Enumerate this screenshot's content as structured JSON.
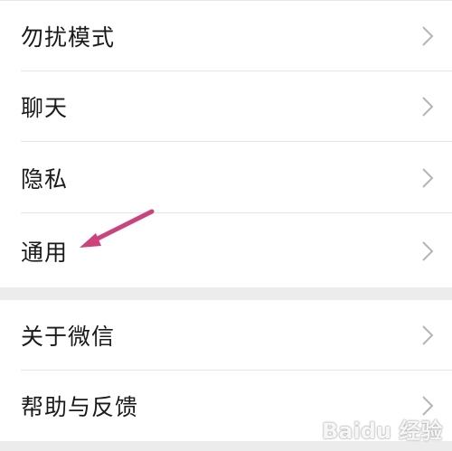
{
  "settings": {
    "group1": [
      {
        "label": "勿扰模式"
      },
      {
        "label": "聊天"
      },
      {
        "label": "隐私"
      },
      {
        "label": "通用"
      }
    ],
    "group2": [
      {
        "label": "关于微信"
      },
      {
        "label": "帮助与反馈"
      }
    ]
  },
  "icons": {
    "row_chevron": "chevron-right-icon",
    "annotation": "arrow-pointer-icon"
  },
  "colors": {
    "background": "#ffffff",
    "group_gap": "#ececec",
    "divider": "#e5e5e5",
    "label_text": "#1a1a1a",
    "chevron": "#b5b5b5",
    "annotation_arrow": "#d0407a"
  },
  "watermark": {
    "text": "Baidu 经验"
  }
}
